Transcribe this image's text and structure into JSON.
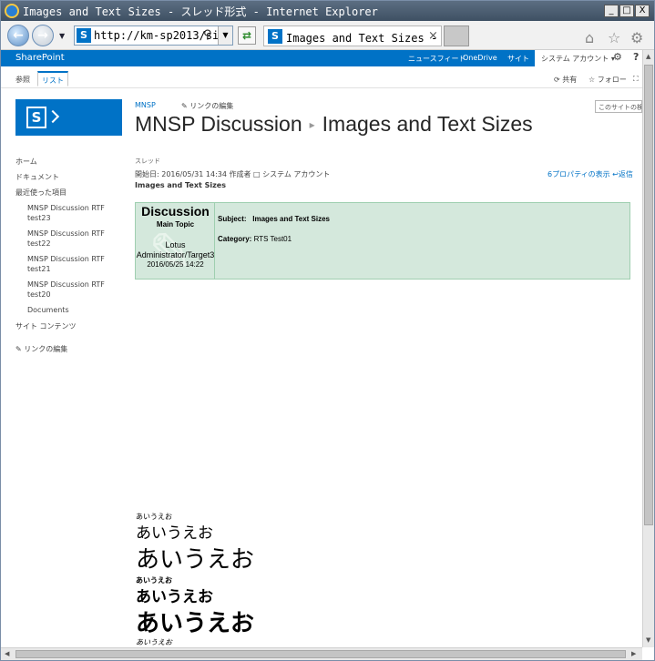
{
  "window": {
    "title": "Images and Text Sizes - スレッド形式 - Internet Explorer",
    "min": "_",
    "max": "□",
    "close": "X"
  },
  "browser": {
    "address": "http://km-sp2013/site",
    "tab_title": "Images and Text Sizes - ス…",
    "tab_close": "×",
    "search_glyph": "⚲",
    "dropdown": "▼"
  },
  "suitebar": {
    "brand": "SharePoint",
    "links": [
      "ニュースフィード",
      "OneDrive",
      "サイト"
    ],
    "account": "システム アカウント ▾",
    "gear": "⚙",
    "help": "?"
  },
  "ribbon": {
    "tabs": [
      "参照",
      "リスト"
    ],
    "share": "共有",
    "follow": "フォロー",
    "focus": "⛶"
  },
  "site": {
    "crumb": "MNSP",
    "edit_links": "リンクの編集",
    "title": "MNSP Discussion",
    "separator": "▸",
    "list_title": "Images and Text Sizes",
    "search_placeholder": "このサイトの検索"
  },
  "leftnav": {
    "home": "ホーム",
    "documents": "ドキュメント",
    "recent": "最近使った項目",
    "recent_items": [
      [
        "MNSP Discussion RTF",
        "test23"
      ],
      [
        "MNSP Discussion RTF",
        "test22"
      ],
      [
        "MNSP Discussion RTF",
        "test21"
      ],
      [
        "MNSP Discussion RTF",
        "test20"
      ]
    ],
    "docs2": "Documents",
    "site_contents": "サイト コンテンツ",
    "edit_links": "リンクの編集"
  },
  "thread": {
    "label": "スレッド",
    "meta": "開始日: 2016/05/31 14:34 作成者 □ システム アカウント",
    "properties": "プロパティの表示",
    "reply": "返信",
    "subject_heading": "Images and Text Sizes"
  },
  "post": {
    "heading": "Discussion",
    "topic": "Main Topic",
    "author_line1": "Lotus",
    "author_line2": "Administrator/Target3",
    "date": "2016/05/25 14:22",
    "subject_label": "Subject:",
    "subject_value": "Images and Text Sizes",
    "category_label": "Category:",
    "category_value": "RTS Test01"
  },
  "jp_text": {
    "s1": "あいうえお",
    "s2": "あいうえお",
    "s3": "あいうえお",
    "s4": "あいうえお",
    "s5": "あいうえお",
    "s6": "あいうえお",
    "s7": "あいうえお"
  },
  "scroll": {
    "up": "▲",
    "down": "▼",
    "left": "◀",
    "right": "▶"
  }
}
